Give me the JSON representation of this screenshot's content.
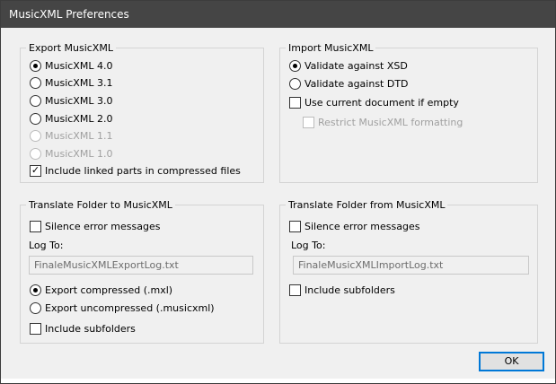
{
  "window": {
    "title": "MusicXML Preferences"
  },
  "export_group": {
    "title": "Export MusicXML",
    "options": [
      {
        "label": "MusicXML 4.0",
        "selected": true,
        "disabled": false
      },
      {
        "label": "MusicXML 3.1",
        "selected": false,
        "disabled": false
      },
      {
        "label": "MusicXML 3.0",
        "selected": false,
        "disabled": false
      },
      {
        "label": "MusicXML 2.0",
        "selected": false,
        "disabled": false
      },
      {
        "label": "MusicXML 1.1",
        "selected": false,
        "disabled": true
      },
      {
        "label": "MusicXML 1.0",
        "selected": false,
        "disabled": true
      }
    ],
    "include_linked": {
      "label": "Include linked parts in compressed files",
      "checked": true
    }
  },
  "import_group": {
    "title": "Import MusicXML",
    "validate_xsd": {
      "label": "Validate against XSD",
      "selected": true
    },
    "validate_dtd": {
      "label": "Validate against DTD",
      "selected": false
    },
    "use_current": {
      "label": "Use current document if empty",
      "checked": false
    },
    "restrict": {
      "label": "Restrict MusicXML formatting",
      "checked": false,
      "disabled": true
    }
  },
  "translate_to": {
    "title": "Translate Folder to MusicXML",
    "silence": {
      "label": "Silence error messages",
      "checked": false
    },
    "log_label": "Log To:",
    "log_value": "FinaleMusicXMLExportLog.txt",
    "export_compressed": {
      "label": "Export compressed (.mxl)",
      "selected": true
    },
    "export_uncompressed": {
      "label": "Export uncompressed (.musicxml)",
      "selected": false
    },
    "subfolders": {
      "label": "Include subfolders",
      "checked": false
    }
  },
  "translate_from": {
    "title": "Translate Folder from MusicXML",
    "silence": {
      "label": "Silence error messages",
      "checked": false
    },
    "log_label": "Log To:",
    "log_value": "FinaleMusicXMLImportLog.txt",
    "subfolders": {
      "label": "Include subfolders",
      "checked": false
    }
  },
  "ok_label": "OK"
}
